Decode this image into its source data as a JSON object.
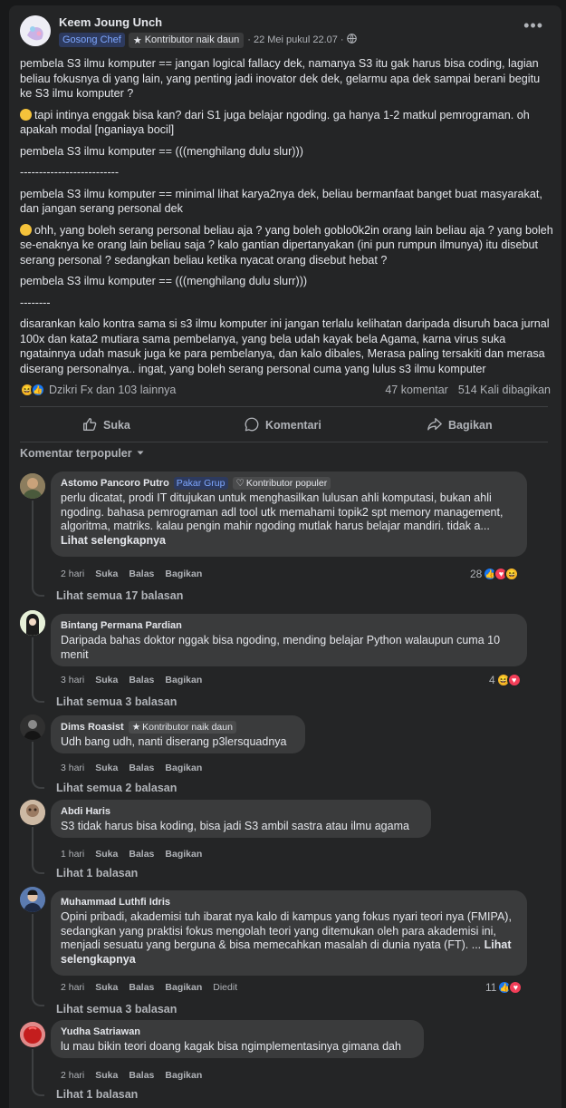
{
  "post": {
    "author": "Keem Joung Unch",
    "group_badge": "Gosong Chef",
    "contributor_badge": "Kontributor naik daun",
    "timestamp": "22 Mei pukul 22.07",
    "privacy_icon": "globe-icon",
    "paragraphs": [
      "pembela S3 ilmu komputer == jangan logical fallacy dek, namanya S3 itu gak harus bisa coding, lagian beliau fokusnya di yang lain, yang penting jadi inovator dek dek, gelarmu apa dek sampai berani begitu ke S3 ilmu komputer ?",
      "tapi intinya enggak bisa kan? dari S1 juga belajar ngoding. ga hanya 1-2 matkul pemrograman. oh apakah modal [nganiaya bocil]",
      "pembela S3 ilmu komputer == (((menghilang dulu slur)))",
      "--------------------------",
      "pembela S3 ilmu komputer == minimal lihat karya2nya dek, beliau bermanfaat banget buat masyarakat,  dan jangan serang personal dek",
      "ohh, yang boleh serang personal beliau aja ? yang boleh goblo0k2in orang lain beliau aja ? yang boleh se-enaknya ke orang lain beliau saja ? kalo gantian dipertanyakan (ini pun rumpun ilmunya) itu disebut serang personal ? sedangkan beliau ketika nyacat orang disebut hebat ?",
      "pembela S3 ilmu komputer == (((menghilang dulu slurr)))",
      "--------",
      "disarankan kalo kontra sama si s3 ilmu komputer ini jangan terlalu kelihatan daripada disuruh baca jurnal 100x dan kata2 mutiara sama pembelanya, yang bela udah kayak bela Agama, karna virus suka ngatainnya udah masuk juga ke para pembelanya, dan kalo dibales, Merasa paling tersakiti dan merasa diserang personalnya.. ingat, yang boleh serang personal cuma yang lulus s3 ilmu komputer"
    ],
    "reactions_text": "Dzikri Fx dan 103 lainnya",
    "comments_count": "47 komentar",
    "shares_count": "514 Kali dibagikan"
  },
  "actions": {
    "like": "Suka",
    "comment": "Komentari",
    "share": "Bagikan"
  },
  "sort_label": "Komentar terpopuler",
  "comments": [
    {
      "author": "Astomo Pancoro Putro",
      "group_badge": "Pakar Grup",
      "contributor_badge": "Kontributor populer",
      "text": "perlu dicatat, prodi IT ditujukan untuk menghasilkan lulusan ahli komputasi, bukan ahli ngoding. bahasa pemrograman adl tool utk memahami topik2 spt memory management, algoritma, matriks. kalau pengin mahir ngoding mutlak harus belajar mandiri. tidak a...",
      "see_more": "Lihat selengkapnya",
      "time": "2 hari",
      "like": "Suka",
      "reply": "Balas",
      "share": "Bagikan",
      "react_count": "28",
      "replies": "Lihat semua 17 balasan"
    },
    {
      "author": "Bintang Permana Pardian",
      "text": "Daripada bahas doktor nggak bisa ngoding, mending belajar Python walaupun cuma 10 menit",
      "time": "3 hari",
      "like": "Suka",
      "reply": "Balas",
      "share": "Bagikan",
      "react_count": "4",
      "replies": "Lihat semua 3 balasan"
    },
    {
      "author": "Dims Roasist",
      "contributor_badge": "Kontributor naik daun",
      "text": "Udh bang udh, nanti diserang p3lersquadnya",
      "time": "3 hari",
      "like": "Suka",
      "reply": "Balas",
      "share": "Bagikan",
      "replies": "Lihat semua 2 balasan"
    },
    {
      "author": "Abdi Haris",
      "text": "S3 tidak harus bisa koding, bisa jadi S3 ambil sastra atau ilmu agama",
      "time": "1 hari",
      "like": "Suka",
      "reply": "Balas",
      "share": "Bagikan",
      "replies": "Lihat 1 balasan"
    },
    {
      "author": "Muhammad Luthfi Idris",
      "text": "Opini pribadi, akademisi tuh ibarat nya kalo di kampus yang fokus nyari teori nya (FMIPA), sedangkan yang praktisi fokus mengolah teori yang ditemukan oleh para akademisi ini, menjadi sesuatu yang berguna & bisa memecahkan masalah di dunia nyata (FT). ...",
      "see_more": "Lihat selengkapnya",
      "time": "2 hari",
      "like": "Suka",
      "reply": "Balas",
      "share": "Bagikan",
      "edited": "Diedit",
      "react_count": "11",
      "replies": "Lihat semua 3 balasan"
    },
    {
      "author": "Yudha Satriawan",
      "text": "lu mau bikin teori doang kagak bisa ngimplementasinya gimana dah",
      "time": "2 hari",
      "like": "Suka",
      "reply": "Balas",
      "share": "Bagikan",
      "replies": "Lihat 1 balasan"
    }
  ],
  "colors": {
    "background": "#18191a",
    "card": "#242526",
    "bubble": "#3a3b3c",
    "like_blue": "#1877f2",
    "love_red": "#f33e58",
    "haha_yellow": "#f7b928"
  }
}
